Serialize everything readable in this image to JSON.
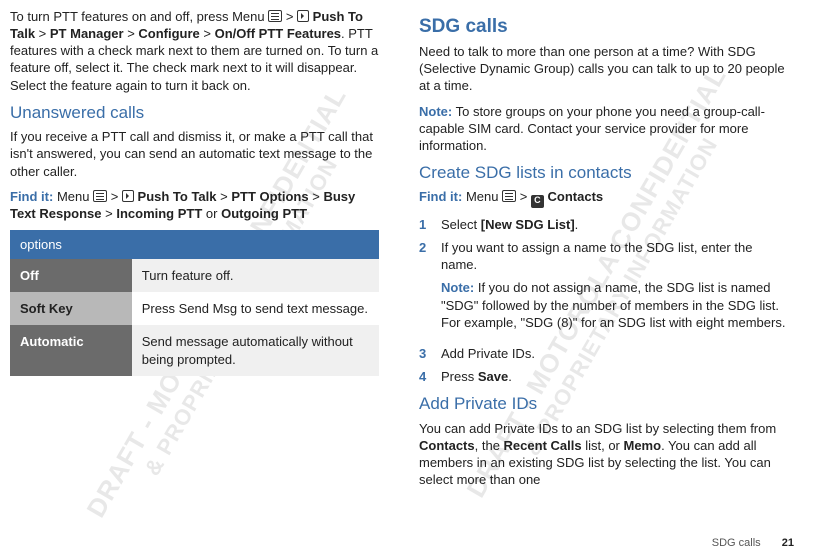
{
  "left": {
    "intro": "To turn PTT features on and off, press Menu ",
    "intro_chain": " > ",
    "intro_ptt": " Push To Talk",
    "intro_rest1": " > ",
    "intro_bold2": "PT Manager",
    "intro_rest2": " > ",
    "intro_bold3": "Configure",
    "intro_rest3": " > ",
    "intro_bold4": "On/Off PTT Features",
    "intro_tail": ". PTT features with a check mark next to them are turned on. To turn a feature off, select it. The check mark next to it will disappear. Select the feature again to turn it back on.",
    "unanswered_h": "Unanswered calls",
    "unanswered_p": "If you receive a PTT call and dismiss it, or make a PTT call that isn't answered, you can send an automatic text message to the other caller.",
    "findit_label": "Find it:",
    "findit_menu": " Menu ",
    "findit_chain1": " > ",
    "findit_ptt": " Push To Talk",
    "findit_chain2": " > ",
    "findit_b2": "PTT Options",
    "findit_chain3": " > ",
    "findit_b3": "Busy Text Response",
    "findit_chain4": " > ",
    "findit_b4": "Incoming PTT",
    "findit_or": " or ",
    "findit_b5": "Outgoing PTT",
    "table": {
      "header": "options",
      "rows": [
        {
          "k": "Off",
          "v": "Turn feature off."
        },
        {
          "k": "Soft Key",
          "v": "Press Send Msg to send text message."
        },
        {
          "k": "Automatic",
          "v": "Send message automatically without being prompted."
        }
      ]
    }
  },
  "right": {
    "sdg_h": "SDG calls",
    "sdg_p": "Need to talk to more than one person at a time? With SDG (Selective Dynamic Group) calls you can talk to up to 20 people at a time.",
    "note_label": "Note:",
    "sdg_note": " To store groups on your phone you need a group-call-capable SIM card. Contact your service provider for more information.",
    "create_h": "Create SDG lists in contacts",
    "findit_label": "Find it:",
    "findit_menu": " Menu ",
    "findit_chain": " > ",
    "findit_contacts": " Contacts",
    "steps": [
      {
        "n": "1",
        "text_a": "Select ",
        "text_b": "[New SDG List]",
        "text_c": "."
      },
      {
        "n": "2",
        "text_a": "If you want to assign a name to the SDG list, enter the name.",
        "note_label": "Note:",
        "note": " If you do not assign a name, the SDG list is named \"SDG\" followed by the number of members in the SDG list. For example, \"SDG (8)\" for an SDG list with eight members."
      },
      {
        "n": "3",
        "text_a": "Add Private IDs."
      },
      {
        "n": "4",
        "text_a": "Press ",
        "text_b": "Save",
        "text_c": "."
      }
    ],
    "add_h": "Add Private IDs",
    "add_p_a": "You can add Private IDs to an SDG list by selecting them from ",
    "add_b1": "Contacts",
    "add_p_b": ", the ",
    "add_b2": "Recent Calls",
    "add_p_c": " list, or ",
    "add_b3": "Memo",
    "add_p_d": ". You can add all members in an existing SDG list by selecting the list. You can select more than one"
  },
  "footer": {
    "section": "SDG calls",
    "page": "21"
  },
  "watermark": {
    "l1": "DRAFT - MOTOROLA CONFIDENTIAL",
    "l2": "& PROPRIETARY INFORMATION"
  }
}
